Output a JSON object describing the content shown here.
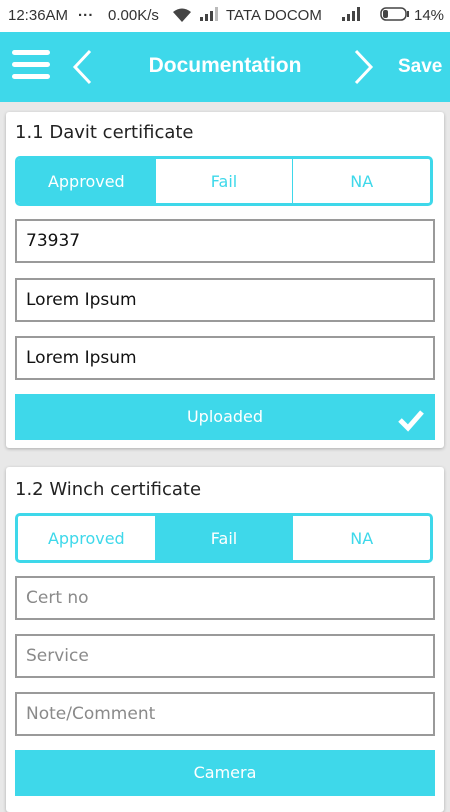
{
  "status_bar": {
    "time": "12:36AM",
    "dots": "...",
    "rate": "0.00K/s",
    "carrier": "TATA DOCOM",
    "battery": "14%"
  },
  "app_bar": {
    "title": "Documentation",
    "save_label": "Save"
  },
  "sections": [
    {
      "title": "1.1 Davit certificate",
      "options": [
        "Approved",
        "Fail",
        "NA"
      ],
      "selected": "Approved",
      "fields": [
        {
          "value": "73937",
          "placeholder": ""
        },
        {
          "value": "Lorem Ipsum",
          "placeholder": ""
        },
        {
          "value": "Lorem Ipsum",
          "placeholder": ""
        }
      ],
      "action_label": "Uploaded"
    },
    {
      "title": "1.2 Winch certificate",
      "options": [
        "Approved",
        "Fail",
        "NA"
      ],
      "selected": "Fail",
      "fields": [
        {
          "value": "",
          "placeholder": "Cert no"
        },
        {
          "value": "",
          "placeholder": "Service"
        },
        {
          "value": "",
          "placeholder": "Note/Comment"
        }
      ],
      "action_label": "Camera"
    }
  ],
  "colors": {
    "accent": "#3ed8ea",
    "field_border": "#9a9a9a",
    "background": "#e8e8e8"
  },
  "icons": [
    "menu-icon",
    "chevron-left-icon",
    "chevron-right-icon",
    "checkmark-icon",
    "wifi-icon",
    "signal-icon",
    "battery-icon"
  ]
}
